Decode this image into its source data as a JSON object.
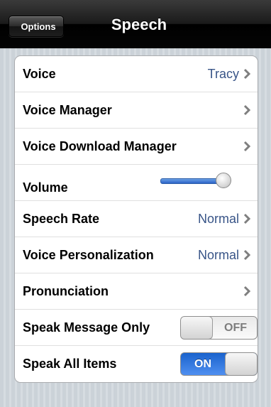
{
  "nav": {
    "back_label": "Options",
    "title": "Speech"
  },
  "rows": [
    {
      "label": "Voice",
      "value": "Tracy",
      "chevron": true
    },
    {
      "label": "Voice Manager",
      "chevron": true
    },
    {
      "label": "Voice Download Manager",
      "chevron": true
    },
    {
      "label": "Volume",
      "control": "slider",
      "level": 0.9
    },
    {
      "label": "Speech Rate",
      "value": "Normal",
      "chevron": true
    },
    {
      "label": "Voice Personalization",
      "value": "Normal",
      "chevron": true
    },
    {
      "label": "Pronunciation",
      "chevron": true
    },
    {
      "label": "Speak Message Only",
      "control": "toggle",
      "state": "OFF"
    },
    {
      "label": "Speak All Items",
      "control": "toggle",
      "state": "ON"
    }
  ],
  "colors": {
    "value_blue": "#385487",
    "toggle_on": "#2b6fd6"
  }
}
